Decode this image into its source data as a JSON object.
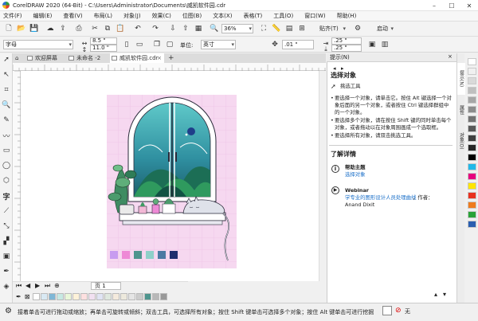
{
  "window": {
    "title": "CorelDRAW 2020 (64-Bit) - C:\\Users\\Administrator\\Documents\\威凯软件园.cdr",
    "controls": [
      "minimize-icon",
      "maximize-icon",
      "close-icon"
    ]
  },
  "menu": [
    "文件(F)",
    "编辑(E)",
    "查看(V)",
    "布局(L)",
    "对象(J)",
    "效果(C)",
    "位图(B)",
    "文本(X)",
    "表格(T)",
    "工具(O)",
    "窗口(W)",
    "帮助(H)"
  ],
  "toolbar": {
    "zoom_value": "36%",
    "snap_label": "贴齐(T)",
    "launch_label": "启动"
  },
  "propbar": {
    "font_label": "字母",
    "width_value": "8.5 \"",
    "height_value": "11.0 \"",
    "units_label": "单位:",
    "units_value": "英寸",
    "nudge_value": ".01 \"",
    "dup_x_value": ".25 \"",
    "dup_y_value": ".25 \""
  },
  "tabs": [
    {
      "label": "欢迎屏幕",
      "active": false
    },
    {
      "label": "未命名 -2",
      "active": false
    },
    {
      "label": "威凯软件园.cdr",
      "active": true
    }
  ],
  "page_nav": {
    "page_label": "页 1"
  },
  "docker": {
    "header": "提示(N)",
    "section_title": "选择对象",
    "tool_name": "挑选工具",
    "bullets": [
      [
        "要选择一个对象，请单击它。按住 Alt 键选择一个对",
        "象后面的另一个对象，或者按住 Ctrl 键选择群组中",
        "的一个对象。"
      ],
      [
        "要选择多个对象，请在按住 Shift 键的同时单击每个",
        "对象，或者拖动以在对象周围画成一个选取框。"
      ],
      [
        "要选择所有对象，请双击挑选工具。"
      ]
    ],
    "learn_more": "了解详情",
    "help_title": "帮助主题",
    "help_link": "选择对象",
    "webinar_title": "Webinar",
    "webinar_link": "学专业的图形设计人员处理曲线",
    "webinar_author_prefix": "，作者：",
    "webinar_author": "Anand Dixit"
  },
  "side_tabs": [
    "提示(N)",
    "属性",
    "对象(O)"
  ],
  "status": {
    "text": "接着单击可进行拖动或缩放；再单击可旋转或倾斜；双击工具，可选择所有对象；按住 Shift 键单击可选择多个对象；按住 Alt 键单击可进行挖掘",
    "fill_label": "无"
  },
  "art": {
    "bg_color": "#f6d8f0",
    "swatches": [
      "#c89bf0",
      "#ee8ad6",
      "#4e958e",
      "#8fd0c9",
      "#4c7aa3",
      "#1f2f6e"
    ]
  },
  "palette_right": [
    "#ffffff",
    "#f0f0f0",
    "#d9d9d9",
    "#bfbfbf",
    "#a6a6a6",
    "#8c8c8c",
    "#737373",
    "#595959",
    "#404040",
    "#262626",
    "#000000",
    "#20b8e8",
    "#e6007e",
    "#ffe500",
    "#e8311f",
    "#ee7b1e",
    "#2aa238",
    "#2a5fb0"
  ],
  "palette_bottom": [
    "#ffffff",
    "#d9e9f3",
    "#7fb7d6",
    "#c7e9e3",
    "#e9f7d9",
    "#fef2d9",
    "#fde0e0",
    "#f1e0f1",
    "#e0e4f4",
    "#dfe8df",
    "#f4eadd",
    "#ede9dd",
    "#e5e5e5",
    "#cccccc",
    "#4e958e",
    "#b8b8b8",
    "#999999"
  ]
}
